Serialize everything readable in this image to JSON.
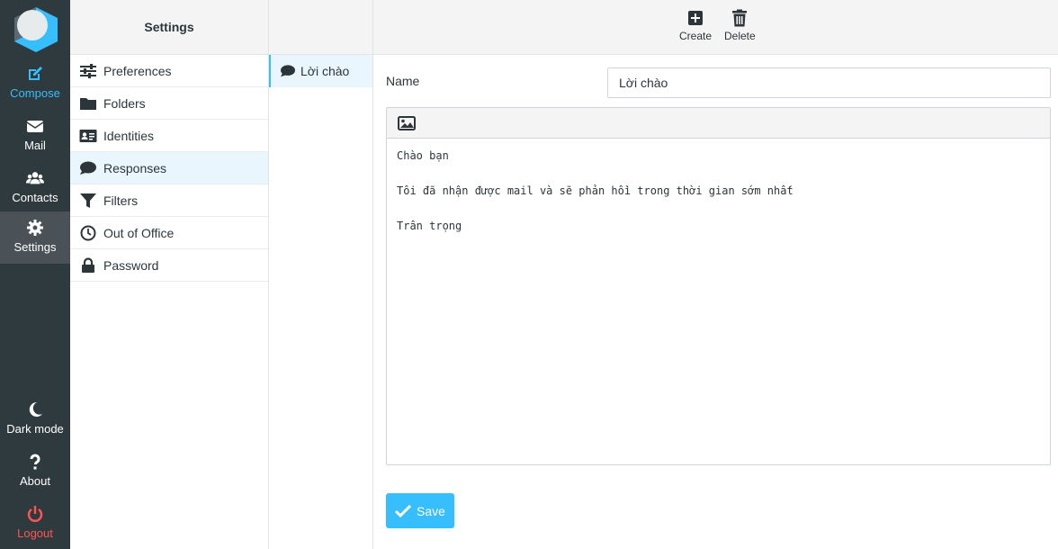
{
  "nav": {
    "compose": "Compose",
    "mail": "Mail",
    "contacts": "Contacts",
    "settings": "Settings",
    "dark_mode": "Dark mode",
    "about": "About",
    "logout": "Logout"
  },
  "settings_pane": {
    "title": "Settings",
    "items": [
      {
        "label": "Preferences",
        "icon": "sliders-icon"
      },
      {
        "label": "Folders",
        "icon": "folder-icon"
      },
      {
        "label": "Identities",
        "icon": "id-card-icon"
      },
      {
        "label": "Responses",
        "icon": "comment-icon",
        "selected": true
      },
      {
        "label": "Filters",
        "icon": "filter-icon"
      },
      {
        "label": "Out of Office",
        "icon": "clock-icon"
      },
      {
        "label": "Password",
        "icon": "lock-icon"
      }
    ]
  },
  "responses": {
    "items": [
      {
        "label": "Lời chào",
        "icon": "comment-icon",
        "selected": true
      }
    ]
  },
  "toolbar": {
    "create": "Create",
    "delete": "Delete"
  },
  "form": {
    "name_label": "Name",
    "name_value": "Lời chào",
    "body": "Chào bạn\n\nTôi đã nhận được mail và sẽ phản hồi trong thời gian sớm nhất\n\nTrân trọng",
    "save_label": "Save"
  },
  "colors": {
    "accent": "#37beff",
    "nav_bg": "#2f3a3f",
    "logout": "#ff5552",
    "selected_bg": "#eaf6fd"
  }
}
